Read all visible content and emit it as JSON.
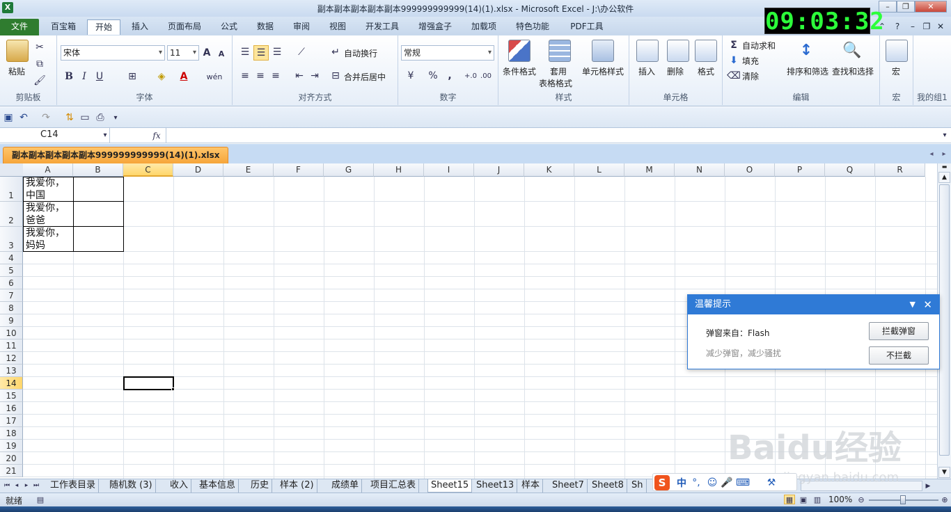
{
  "window": {
    "title": "副本副本副本副本副本999999999999(14)(1).xlsx  -  Microsoft Excel - J:\\办公软件",
    "app_icon": "excel-icon",
    "clock": "09:03:32"
  },
  "ribbon_tabs": [
    "文件",
    "百宝箱",
    "开始",
    "插入",
    "页面布局",
    "公式",
    "数据",
    "审阅",
    "视图",
    "开发工具",
    "增强盒子",
    "加载项",
    "特色功能",
    "PDF工具"
  ],
  "ribbon": {
    "clipboard": {
      "paste": "粘贴",
      "label": "剪贴板"
    },
    "font": {
      "family": "宋体",
      "size": "11",
      "label": "字体",
      "bold": "B",
      "italic": "I",
      "underline": "U",
      "wen": "wén",
      "grow": "A",
      "shrink": "A"
    },
    "align": {
      "wrap": "自动换行",
      "merge": "合并后居中",
      "label": "对齐方式"
    },
    "number": {
      "format": "常规",
      "label": "数字",
      "percent": "%",
      "comma": ","
    },
    "styles": {
      "cond": "条件格式",
      "table1": "套用",
      "table2": "表格格式",
      "cellstyle": "单元格样式",
      "label": "样式"
    },
    "cells": {
      "insert": "插入",
      "delete": "删除",
      "format": "格式",
      "label": "单元格"
    },
    "edit": {
      "autosum": "自动求和",
      "fill": "填充",
      "clear": "清除",
      "sort": "排序和筛选",
      "find": "查找和选择",
      "label": "编辑"
    },
    "macro": {
      "macro": "宏",
      "label": "宏"
    },
    "mygroup": {
      "label": "我的组1"
    }
  },
  "formula_bar": {
    "name_box": "C14",
    "fx": "fx",
    "formula": ""
  },
  "workbook_tab": "副本副本副本副本副本999999999999(14)(1).xlsx",
  "columns": [
    "A",
    "B",
    "C",
    "D",
    "E",
    "F",
    "G",
    "H",
    "I",
    "J",
    "K",
    "L",
    "M",
    "N",
    "O",
    "P",
    "Q",
    "R"
  ],
  "rows": [
    "1",
    "2",
    "3",
    "4",
    "5",
    "6",
    "7",
    "8",
    "9",
    "10",
    "11",
    "12",
    "13",
    "14",
    "15",
    "16",
    "17",
    "18",
    "19",
    "20",
    "21"
  ],
  "cells": {
    "A1": [
      "我爱你，",
      "中国"
    ],
    "A2": [
      "我爱你，",
      "爸爸"
    ],
    "A3": [
      "我爱你，",
      "妈妈"
    ]
  },
  "sheet_tabs": [
    "工作表目录",
    "随机数 (3)",
    "收入",
    "基本信息",
    "历史",
    "样本 (2)",
    "成绩单",
    "项目汇总表",
    "Sheet15",
    "Sheet13",
    "样本",
    "Sheet7",
    "Sheet8",
    "Sh"
  ],
  "active_sheet": "Sheet15",
  "status": {
    "ready": "就绪",
    "zoom": "100%"
  },
  "popup": {
    "title": "温馨提示",
    "source": "弹窗来自：Flash",
    "hint": "减少弹窗，减少骚扰",
    "block": "拦截弹窗",
    "noblock": "不拦截"
  },
  "ime": {
    "label": "中"
  },
  "watermark": {
    "brand": "Baidu经验",
    "url": "jingyan.baidu.com"
  }
}
